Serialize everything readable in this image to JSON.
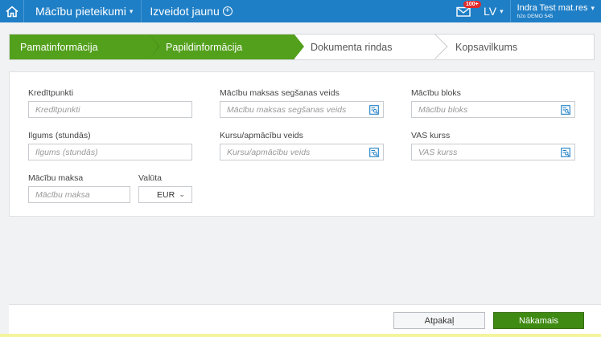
{
  "topbar": {
    "module_label": "Mācību pieteikumi",
    "create_label": "Izveidot jaunu",
    "notifications_badge": "100+",
    "language": "LV",
    "user_name": "Indra Test mat.res",
    "user_org": "h2o DEMO 545"
  },
  "wizard": {
    "steps": [
      {
        "label": "Pamatinformācija",
        "state": "done"
      },
      {
        "label": "Papildinformācija",
        "state": "current"
      },
      {
        "label": "Dokumenta rindas",
        "state": "pending"
      },
      {
        "label": "Kopsavilkums",
        "state": "pending"
      }
    ]
  },
  "form": {
    "credit_points": {
      "label": "Kredītpunkti",
      "placeholder": "Kredītpunkti"
    },
    "payment_method": {
      "label": "Mācību maksas segšanas veids",
      "placeholder": "Mācību maksas segšanas veids"
    },
    "study_block": {
      "label": "Mācību bloks",
      "placeholder": "Mācību bloks"
    },
    "duration_hours": {
      "label": "Ilgums (stundās)",
      "placeholder": "Ilgums (stundās)"
    },
    "course_type": {
      "label": "Kursu/apmācību veids",
      "placeholder": "Kursu/apmācību veids"
    },
    "vas_course": {
      "label": "VAS kurss",
      "placeholder": "VAS kurss"
    },
    "tuition_fee": {
      "label": "Mācību maksa",
      "placeholder": "Mācību maksa"
    },
    "currency": {
      "label": "Valūta",
      "value": "EUR"
    }
  },
  "footer": {
    "back_label": "Atpakaļ",
    "next_label": "Nākamais"
  },
  "colors": {
    "topbar": "#1f7fc6",
    "step_done": "#53a01c",
    "next_button": "#3f8a12"
  }
}
